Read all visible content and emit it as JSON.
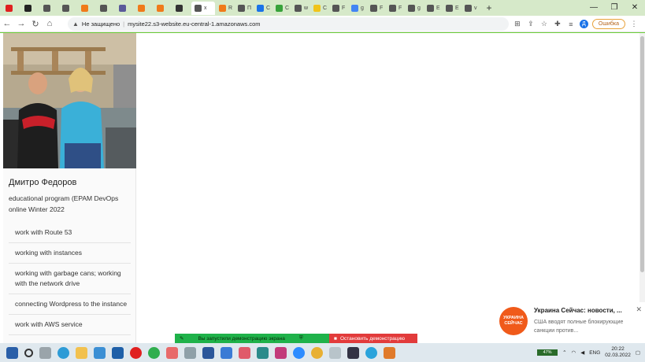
{
  "browser": {
    "active_tab_label": "x",
    "address_warning": "Не защищено",
    "url": "mysite22.s3-website.eu-central-1.amazonaws.com",
    "profile_initial": "Д",
    "error_button": "Ошибка",
    "new_tab": "+"
  },
  "tabs": [
    {
      "color": "#e02020",
      "label": ""
    },
    {
      "color": "#222222",
      "label": ""
    },
    {
      "color": "#555555",
      "label": ""
    },
    {
      "color": "#555555",
      "label": ""
    },
    {
      "color": "#f07a1a",
      "label": ""
    },
    {
      "color": "#555555",
      "label": ""
    },
    {
      "color": "#5a5a9a",
      "label": ""
    },
    {
      "color": "#f07a1a",
      "label": ""
    },
    {
      "color": "#f07a1a",
      "label": ""
    },
    {
      "color": "#333333",
      "label": ""
    },
    {
      "color": "#555555",
      "label": "x",
      "active": true
    },
    {
      "color": "#f07a1a",
      "label": "R"
    },
    {
      "color": "#555555",
      "label": "П"
    },
    {
      "color": "#1a73e8",
      "label": "C"
    },
    {
      "color": "#37a23a",
      "label": "C"
    },
    {
      "color": "#555555",
      "label": "w"
    },
    {
      "color": "#f0c419",
      "label": "C"
    },
    {
      "color": "#555555",
      "label": "F"
    },
    {
      "color": "#4285f4",
      "label": "g"
    },
    {
      "color": "#555555",
      "label": "F"
    },
    {
      "color": "#555555",
      "label": "F"
    },
    {
      "color": "#555555",
      "label": "g"
    },
    {
      "color": "#555555",
      "label": "E"
    },
    {
      "color": "#555555",
      "label": "E"
    },
    {
      "color": "#555555",
      "label": "v"
    }
  ],
  "profile": {
    "name": "Дмитро Федоров",
    "subtitle": "educational program (EPAM DevOps online Winter 2022"
  },
  "menu": [
    "work with Route 53",
    "working with instances",
    "working with garbage cans; working with the network drive",
    "connecting Wordpress to the instance",
    "work with AWS service"
  ],
  "notification": {
    "logo_text": "УКРАИНА СЕЙЧАС",
    "title": "Украина Сейчас: новости, ...",
    "body": "США вводят полные блокирующие санкции против..."
  },
  "share": {
    "started": "Вы запустили демонстрацию экрана",
    "stop": "Остановить демонстрацию"
  },
  "taskbar": {
    "battery": "47%",
    "language": "ENG",
    "time": "20:22",
    "date": "02.03.2022"
  },
  "colors": {
    "screen_share_border": "#6ccf3a",
    "notification_logo": "#f05a1a"
  }
}
